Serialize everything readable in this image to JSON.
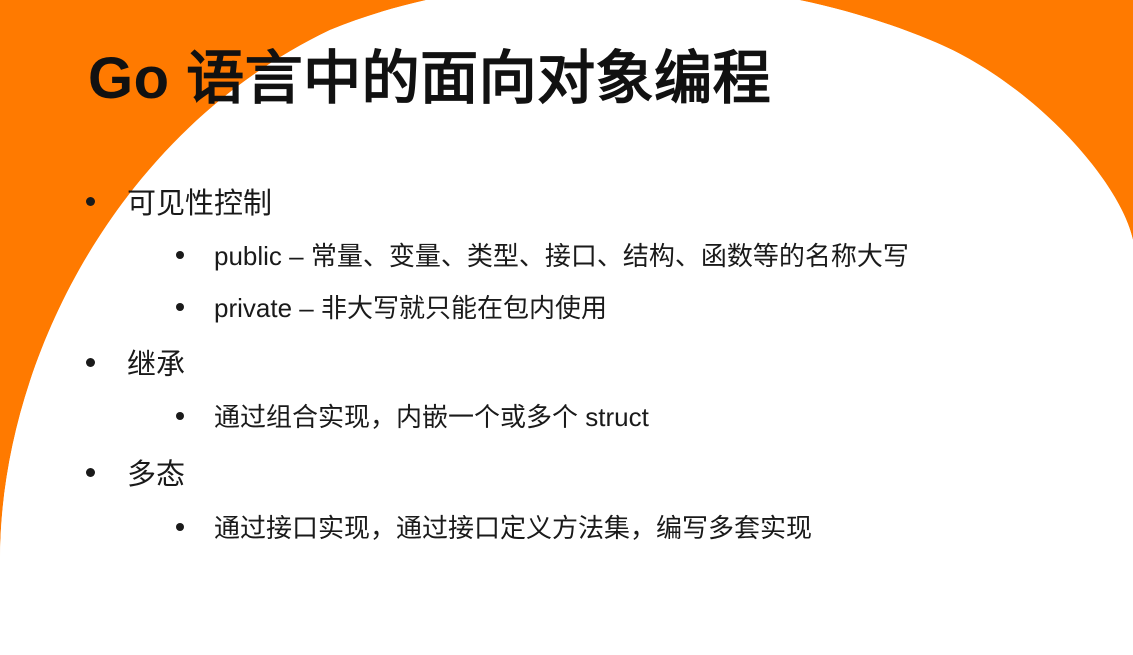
{
  "slide": {
    "title": "Go 语言中的面向对象编程",
    "accent_color": "#ff7a00",
    "bullets": [
      {
        "text": "可见性控制",
        "children": [
          "public – 常量、变量、类型、接口、结构、函数等的名称大写",
          "private – 非大写就只能在包内使用"
        ]
      },
      {
        "text": "继承",
        "children": [
          "通过组合实现，内嵌一个或多个 struct"
        ]
      },
      {
        "text": "多态",
        "children": [
          "通过接口实现，通过接口定义方法集，编写多套实现"
        ]
      }
    ]
  }
}
